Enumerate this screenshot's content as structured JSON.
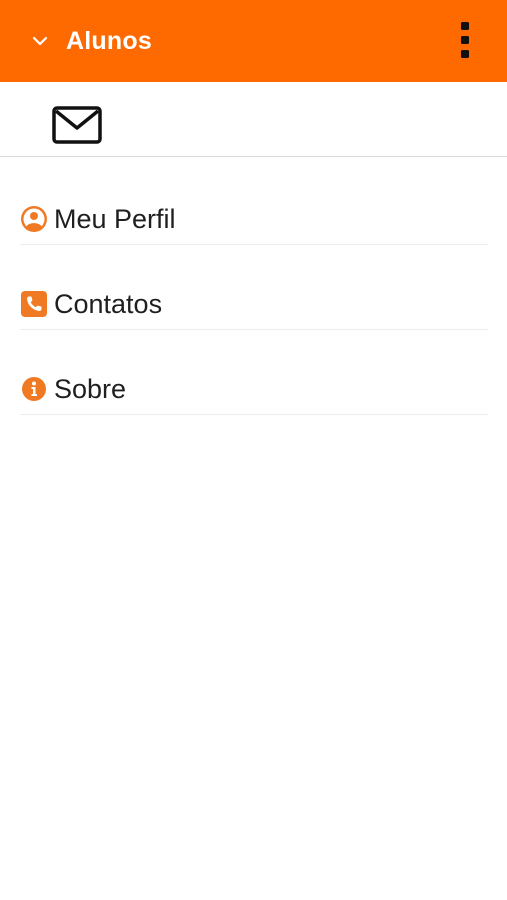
{
  "theme": {
    "accent": "#FF6A00",
    "accent_icon": "#F07A24",
    "text": "#1f1f1f"
  },
  "appbar": {
    "title": "Alunos",
    "dropdown_icon": "chevron-down-icon",
    "overflow_icon": "more-vert-icon"
  },
  "toolbar": {
    "mail_icon": "mail-icon"
  },
  "menu": {
    "items": [
      {
        "label": "Meu Perfil",
        "icon": "user-circle-icon"
      },
      {
        "label": "Contatos",
        "icon": "phone-icon"
      },
      {
        "label": "Sobre",
        "icon": "info-icon"
      }
    ]
  }
}
